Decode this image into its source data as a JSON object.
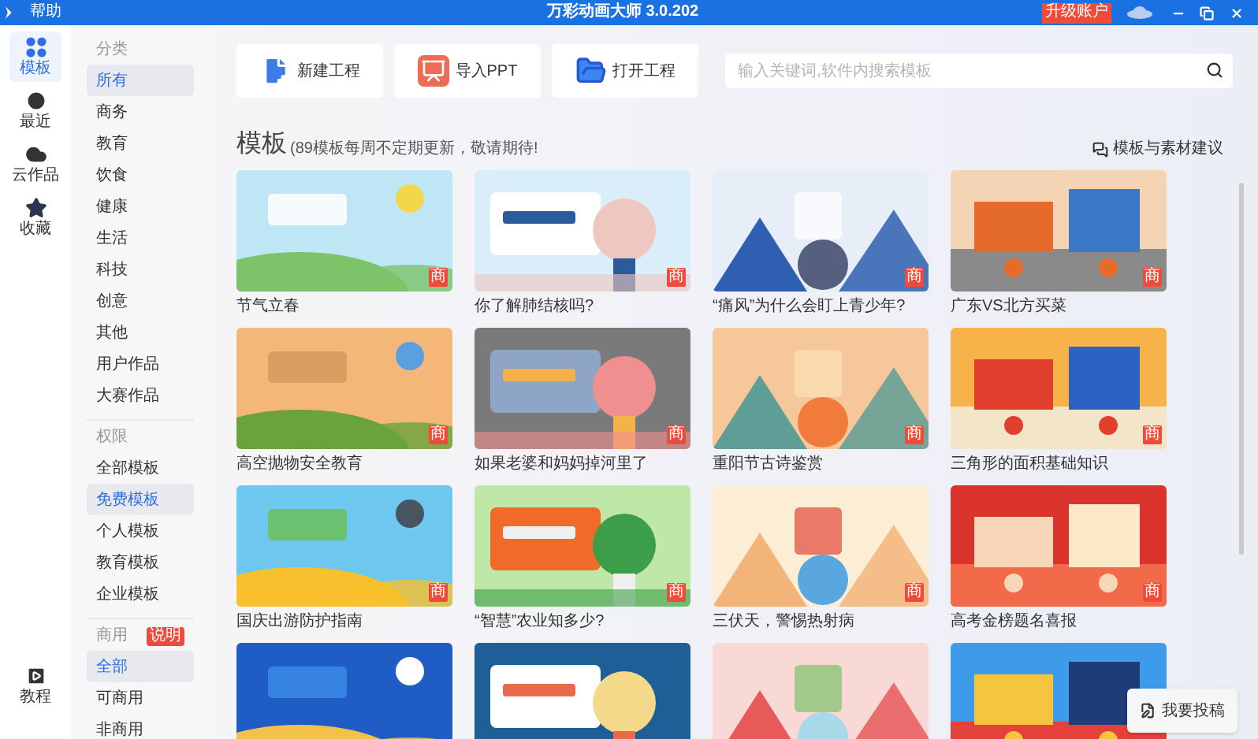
{
  "title_bar": {
    "menu": "帮助",
    "title": "万彩动画大师 3.0.202",
    "upgrade": "升级账户"
  },
  "nav": [
    {
      "label": "模板",
      "selected": true
    },
    {
      "label": "最近",
      "selected": false
    },
    {
      "label": "云作品",
      "selected": false
    },
    {
      "label": "收藏",
      "selected": false
    }
  ],
  "nav_bottom": {
    "label": "教程"
  },
  "filters": [
    {
      "header": "分类",
      "items": [
        {
          "label": "所有",
          "selected": true
        },
        {
          "label": "商务",
          "selected": false
        },
        {
          "label": "教育",
          "selected": false
        },
        {
          "label": "饮食",
          "selected": false
        },
        {
          "label": "健康",
          "selected": false
        },
        {
          "label": "生活",
          "selected": false
        },
        {
          "label": "科技",
          "selected": false
        },
        {
          "label": "创意",
          "selected": false
        },
        {
          "label": "其他",
          "selected": false
        },
        {
          "label": "用户作品",
          "selected": false
        },
        {
          "label": "大赛作品",
          "selected": false
        }
      ]
    },
    {
      "header": "权限",
      "items": [
        {
          "label": "全部模板",
          "selected": false
        },
        {
          "label": "免费模板",
          "selected": true
        },
        {
          "label": "个人模板",
          "selected": false
        },
        {
          "label": "教育模板",
          "selected": false
        },
        {
          "label": "企业模板",
          "selected": false
        }
      ]
    },
    {
      "header": "商用",
      "badge": "说明",
      "items": [
        {
          "label": "全部",
          "selected": true
        },
        {
          "label": "可商用",
          "selected": false
        },
        {
          "label": "非商用",
          "selected": false
        }
      ]
    }
  ],
  "actions": [
    {
      "label": "新建工程"
    },
    {
      "label": "导入PPT"
    },
    {
      "label": "打开工程"
    }
  ],
  "search": {
    "placeholder": "输入关键词,软件内搜索模板"
  },
  "section": {
    "title": "模板",
    "subtitle": "(89模板每周不定期更新，敬请期待!",
    "suggest": "模板与素材建议"
  },
  "cards": [
    {
      "kind": "picture",
      "title": "节气立春",
      "badge": "商"
    },
    {
      "kind": "picture",
      "title": "你了解肺结核吗?",
      "badge": "商"
    },
    {
      "kind": "picture",
      "title": "“痛风”为什么会盯上青少年?",
      "badge": "商"
    },
    {
      "kind": "picture",
      "title": "广东VS北方买菜",
      "badge": "商"
    },
    {
      "kind": "picture",
      "title": "高空抛物安全教育",
      "badge": "商"
    },
    {
      "kind": "picture",
      "title": "如果老婆和妈妈掉河里了",
      "badge": "商"
    },
    {
      "kind": "picture",
      "title": "重阳节古诗鉴赏",
      "badge": "商"
    },
    {
      "kind": "picture",
      "title": "三角形的面积基础知识",
      "badge": "商"
    },
    {
      "kind": "picture",
      "title": "国庆出游防护指南",
      "badge": "商"
    },
    {
      "kind": "picture",
      "title": "“智慧”农业知多少?",
      "badge": "商"
    },
    {
      "kind": "picture",
      "title": "三伏天，警惕热射病",
      "badge": "商"
    },
    {
      "kind": "picture",
      "title": "高考金榜题名喜报",
      "badge": "商"
    },
    {
      "kind": "picture"
    },
    {
      "kind": "picture"
    },
    {
      "kind": "picture"
    },
    {
      "kind": "picture"
    }
  ],
  "submit_button": "我要投稿"
}
